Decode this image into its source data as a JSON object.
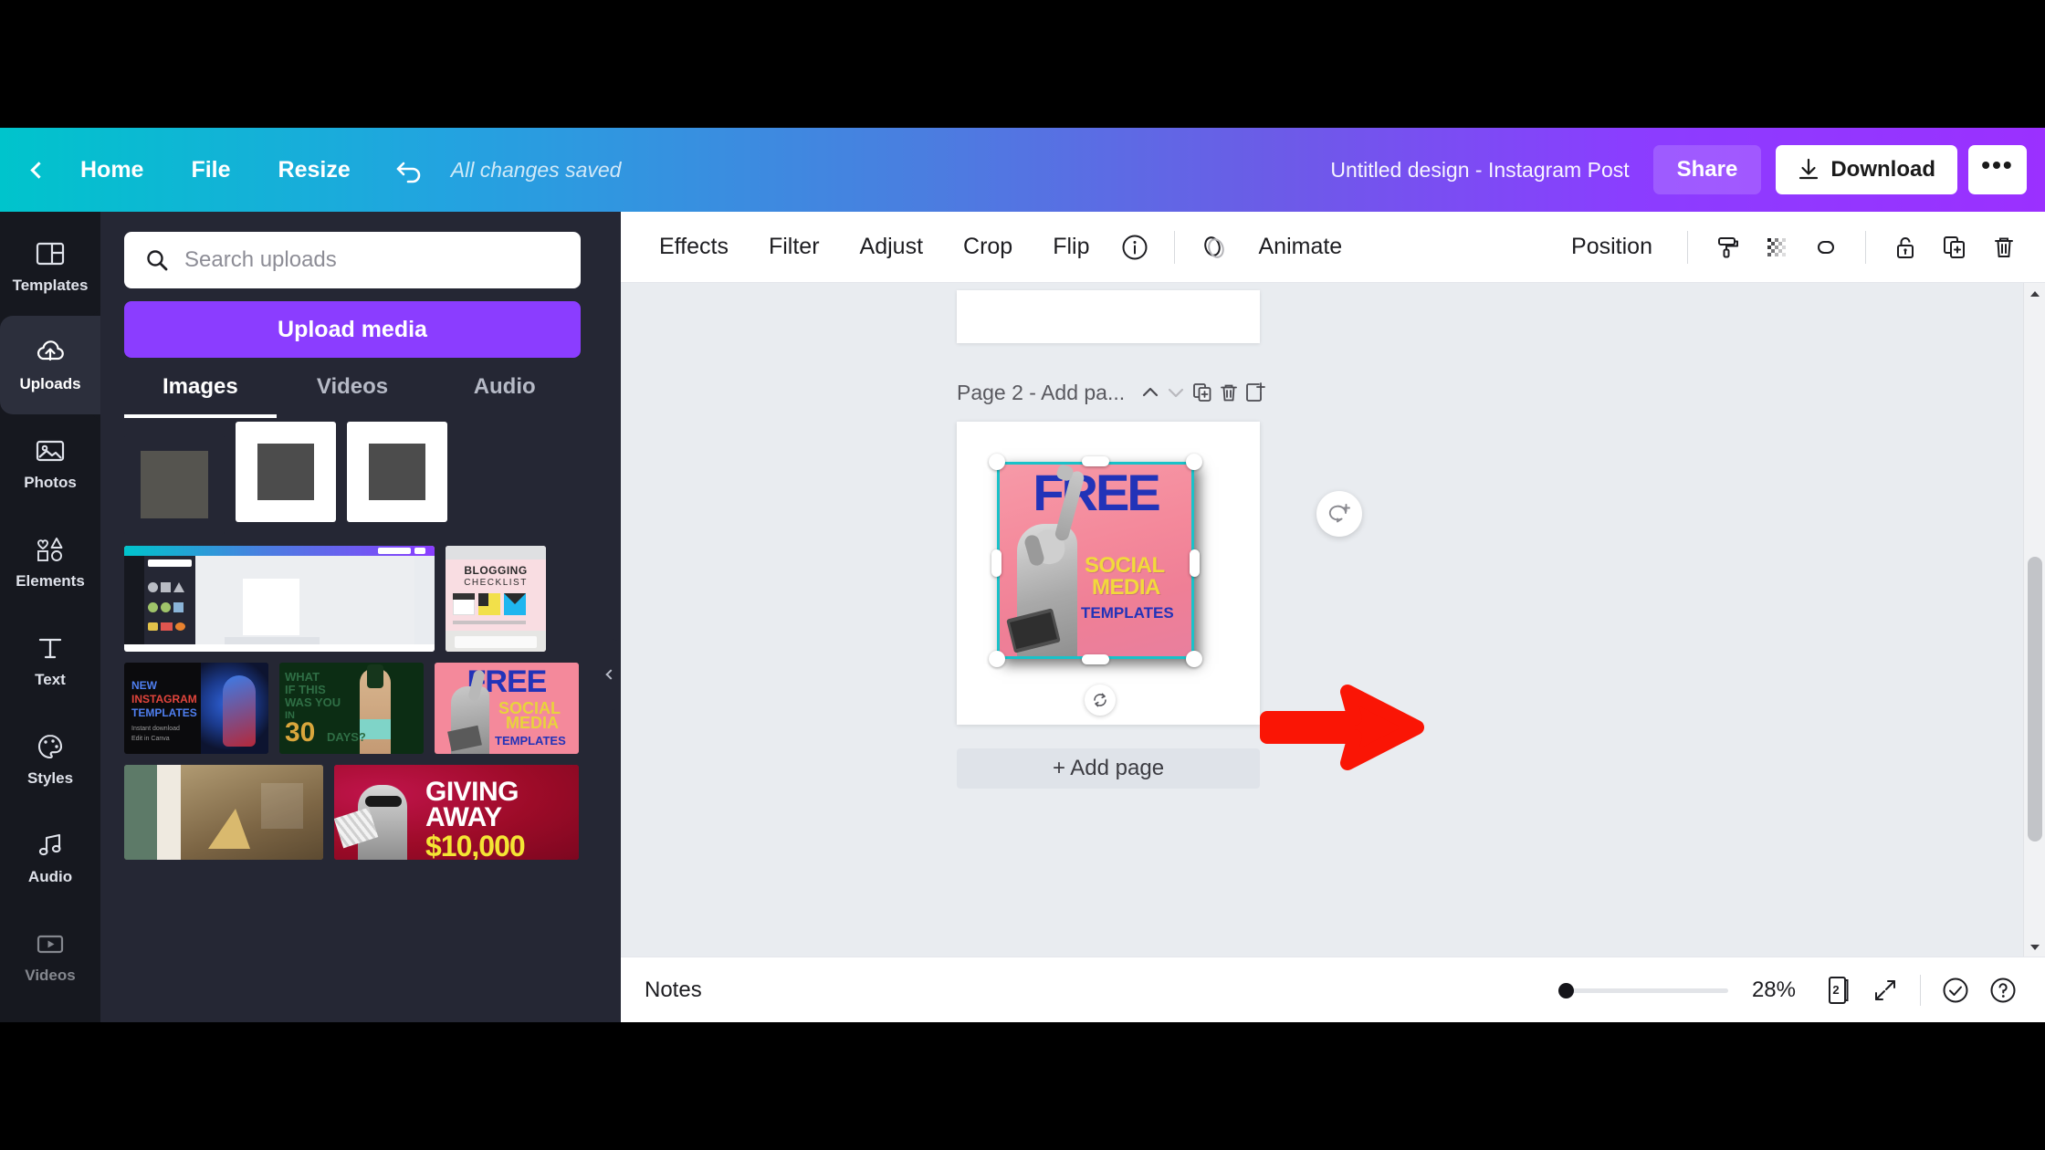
{
  "header": {
    "back_icon": "chevron-left-icon",
    "home_label": "Home",
    "file_label": "File",
    "resize_label": "Resize",
    "undo_icon": "undo-arrow-icon",
    "saved_status": "All changes saved",
    "design_title": "Untitled design - Instagram Post",
    "share_label": "Share",
    "download_label": "Download",
    "download_icon": "download-icon",
    "more_label": "•••"
  },
  "rail": {
    "items": [
      {
        "label": "Templates",
        "icon": "templates-icon",
        "active": false
      },
      {
        "label": "Uploads",
        "icon": "upload-cloud-icon",
        "active": true
      },
      {
        "label": "Photos",
        "icon": "photos-icon",
        "active": false
      },
      {
        "label": "Elements",
        "icon": "elements-icon",
        "active": false
      },
      {
        "label": "Text",
        "icon": "text-icon",
        "active": false
      },
      {
        "label": "Styles",
        "icon": "styles-palette-icon",
        "active": false
      },
      {
        "label": "Audio",
        "icon": "audio-note-icon",
        "active": false
      },
      {
        "label": "Videos",
        "icon": "videos-icon",
        "active": false
      }
    ]
  },
  "panel": {
    "search_placeholder": "Search uploads",
    "search_value": "",
    "search_icon": "search-icon",
    "upload_button": "Upload media",
    "tabs": [
      {
        "label": "Images",
        "active": true
      },
      {
        "label": "Videos",
        "active": false
      },
      {
        "label": "Audio",
        "active": false
      }
    ],
    "thumbnails": [
      {
        "name": "gray-square-upload"
      },
      {
        "name": "white-frame-upload-1"
      },
      {
        "name": "white-frame-upload-2"
      },
      {
        "name": "canva-editor-screenshot"
      },
      {
        "name": "blogging-checklist",
        "title": "BLOGGING",
        "subtitle": "CHECKLIST"
      },
      {
        "name": "new-instagram-templates",
        "line1": "NEW",
        "line2": "INSTAGRAM",
        "line3": "TEMPLATES",
        "sub": "Instant download\nEdit in Canva"
      },
      {
        "name": "what-if-this-was-you",
        "line1": "WHAT",
        "line2": "IF THIS",
        "line3": "WAS YOU",
        "line4": "IN",
        "big": "30",
        "line5": "DAYS?"
      },
      {
        "name": "free-social-media-templates",
        "line1": "FREE",
        "line2": "SOCIAL",
        "line3": "MEDIA",
        "line4": "TEMPLATES"
      },
      {
        "name": "interior-photo-upload"
      },
      {
        "name": "giving-away-promo",
        "line1": "GIVING",
        "line2": "AWAY",
        "line3": "$10,000"
      }
    ]
  },
  "toolbar": {
    "effects_label": "Effects",
    "filter_label": "Filter",
    "adjust_label": "Adjust",
    "crop_label": "Crop",
    "flip_label": "Flip",
    "info_icon": "info-circle-icon",
    "animate_icon": "animate-icon",
    "animate_label": "Animate",
    "position_label": "Position",
    "icons": [
      {
        "name": "paint-roller-icon"
      },
      {
        "name": "transparency-grid-icon"
      },
      {
        "name": "link-icon"
      },
      {
        "name": "lock-icon"
      },
      {
        "name": "duplicate-icon"
      },
      {
        "name": "trash-icon"
      }
    ]
  },
  "canvas": {
    "page_label": "Page 2 - Add pa...",
    "page_icons": [
      {
        "name": "move-up-icon"
      },
      {
        "name": "move-down-icon"
      },
      {
        "name": "duplicate-page-icon"
      },
      {
        "name": "delete-page-icon"
      },
      {
        "name": "add-page-after-icon"
      }
    ],
    "rotate_icon": "rotate-handle-icon",
    "comment_icon": "add-comment-icon",
    "add_page_label": "+ Add page",
    "selected_image": {
      "name": "free-social-media-templates-artwork",
      "line1": "FREE",
      "line2": "SOCIAL",
      "line3": "MEDIA",
      "line4": "TEMPLATES",
      "bg_color": "#f4899b",
      "headline_color": "#2233b8",
      "accent_color": "#f5e03c"
    },
    "annotation": {
      "name": "red-arrow-annotation",
      "color": "#fa1505"
    }
  },
  "statusbar": {
    "notes_label": "Notes",
    "zoom_value": "28%",
    "zoom_percent": 28,
    "page_count": "2",
    "icons": [
      {
        "name": "page-manager-icon"
      },
      {
        "name": "fullscreen-icon"
      },
      {
        "name": "check-circle-icon"
      },
      {
        "name": "help-circle-icon"
      }
    ]
  }
}
